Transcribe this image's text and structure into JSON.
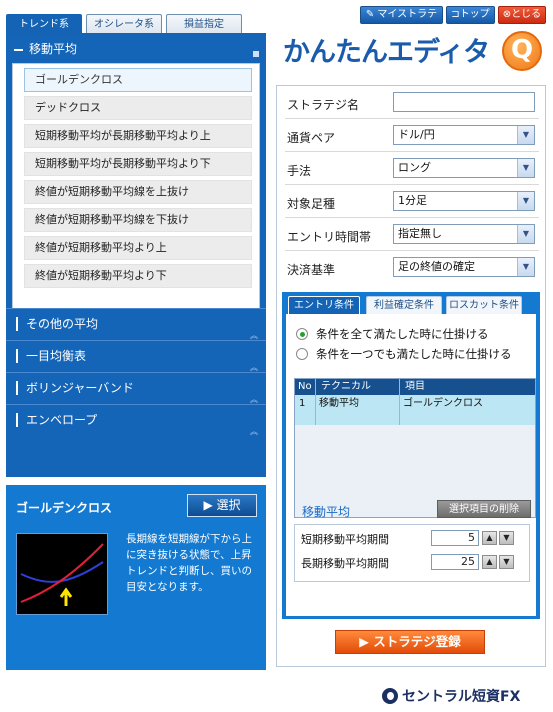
{
  "tabs": [
    "トレンド系",
    "オシレータ系",
    "損益指定"
  ],
  "top_buttons": {
    "my_strategy": "マイストラテジ",
    "top": "トップ",
    "close": "とじる"
  },
  "brand": {
    "title": "かんたんエディタ",
    "q": "Q"
  },
  "category_open": "移動平均",
  "items": [
    "ゴールデンクロス",
    "デッドクロス",
    "短期移動平均が長期移動平均より上",
    "短期移動平均が長期移動平均より下",
    "終値が短期移動平均線を上抜け",
    "終値が短期移動平均線を下抜け",
    "終値が短期移動平均より上",
    "終値が短期移動平均より下"
  ],
  "categories": [
    "その他の平均",
    "一目均衡表",
    "ボリンジャーバンド",
    "エンベロープ"
  ],
  "detail": {
    "title": "ゴールデンクロス",
    "select_label": "選択",
    "description": "長期線を短期線が下から上に突き抜ける状態で、上昇トレンドと判断し、買いの目安となります。"
  },
  "form": {
    "strategy_name_label": "ストラテジ名",
    "strategy_name_value": "",
    "pair_label": "通貨ペア",
    "pair_value": "ドル/円",
    "method_label": "手法",
    "method_value": "ロング",
    "bar_label": "対象足種",
    "bar_value": "1分足",
    "time_label": "エントリ時間帯",
    "time_value": "指定無し",
    "settle_label": "決済基準",
    "settle_value": "足の終値の確定"
  },
  "cond_tabs": [
    "エントリ条件",
    "利益確定条件",
    "ロスカット条件"
  ],
  "radio": {
    "all": "条件を全て満たした時に仕掛ける",
    "any": "条件を一つでも満たした時に仕掛ける"
  },
  "table": {
    "headers": {
      "no": "No",
      "tech": "テクニカル",
      "item": "項目"
    },
    "rows": [
      {
        "no": "1",
        "tech": "移動平均",
        "item": "ゴールデンクロス"
      }
    ]
  },
  "section": {
    "title": "移動平均",
    "delete_label": "選択項目の削除"
  },
  "params": [
    {
      "label": "短期移動平均期間",
      "value": "5"
    },
    {
      "label": "長期移動平均期間",
      "value": "25"
    }
  ],
  "register_label": "ストラテジ登録",
  "footer_logo": "セントラル短資FX",
  "colors": {
    "primary_blue": "#1464b8",
    "accent_orange": "#f07716",
    "close_red": "#e03a1e"
  }
}
